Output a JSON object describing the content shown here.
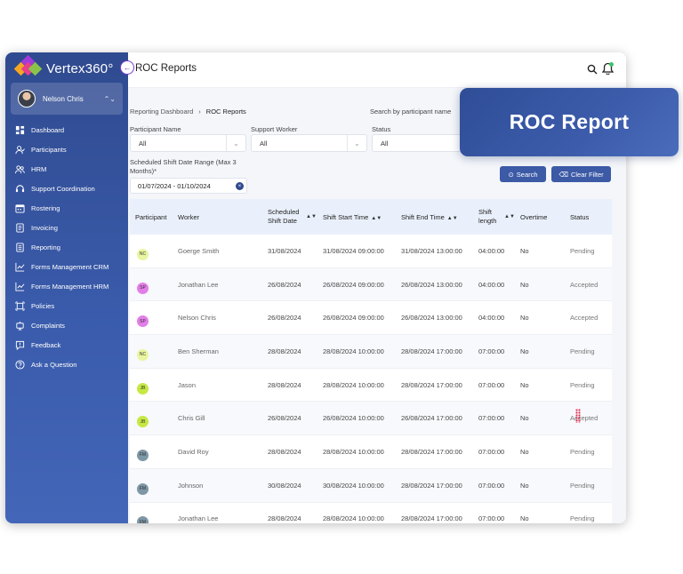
{
  "brand": {
    "name": "Vertex360°"
  },
  "user": {
    "name": "Nelson Chris"
  },
  "sidebar": {
    "items": [
      {
        "label": "Dashboard",
        "icon": "dashboard-icon"
      },
      {
        "label": "Participants",
        "icon": "participants-icon"
      },
      {
        "label": "HRM",
        "icon": "hrm-icon"
      },
      {
        "label": "Support Coordination",
        "icon": "support-icon"
      },
      {
        "label": "Rostering",
        "icon": "calendar-icon"
      },
      {
        "label": "Invoicing",
        "icon": "invoice-icon"
      },
      {
        "label": "Reporting",
        "icon": "report-icon"
      },
      {
        "label": "Forms Management CRM",
        "icon": "chart-icon"
      },
      {
        "label": "Forms Management HRM",
        "icon": "chart-icon"
      },
      {
        "label": "Policies",
        "icon": "policies-icon"
      },
      {
        "label": "Complaints",
        "icon": "complaints-icon"
      },
      {
        "label": "Feedback",
        "icon": "feedback-icon"
      },
      {
        "label": "Ask a Question",
        "icon": "question-icon"
      }
    ]
  },
  "header": {
    "title": "ROC Reports"
  },
  "breadcrumb": {
    "root": "Reporting Dashboard",
    "current": "ROC Reports"
  },
  "filters": {
    "search_label": "Search by participant name",
    "participant_label": "Participant Name",
    "participant_value": "All",
    "worker_label": "Support Worker",
    "worker_value": "All",
    "status_label": "Status",
    "status_value": "All",
    "date_label": "Scheduled Shift Date Range (Max 3 Months)*",
    "date_value": "01/07/2024 - 01/10/2024",
    "search_button": "Search",
    "clear_button": "Clear Filter"
  },
  "table": {
    "headers": {
      "participant": "Participant",
      "worker": "Worker",
      "date": "Scheduled Shift Date",
      "start": "Shift Start Time",
      "end": "Shift End Time",
      "length": "Shift length",
      "overtime": "Overtime",
      "status": "Status"
    },
    "rows": [
      {
        "initials": "NC",
        "badge": "#e9f5a0",
        "worker": "Goerge Smith",
        "date": "31/08/2024",
        "start": "31/08/2024 09:00:00",
        "end": "31/08/2024 13:00:00",
        "length": "04:00:00",
        "overtime": "No",
        "status": "Pending"
      },
      {
        "initials": "SP",
        "badge": "#e27ee8",
        "worker": "Jonathan Lee",
        "date": "26/08/2024",
        "start": "26/08/2024 09:00:00",
        "end": "26/08/2024 13:00:00",
        "length": "04:00:00",
        "overtime": "No",
        "status": "Accepted"
      },
      {
        "initials": "SP",
        "badge": "#e27ee8",
        "worker": "Nelson Chris",
        "date": "26/08/2024",
        "start": "26/08/2024 09:00:00",
        "end": "26/08/2024 13:00:00",
        "length": "04:00:00",
        "overtime": "No",
        "status": "Accepted"
      },
      {
        "initials": "NC",
        "badge": "#e9f5a0",
        "worker": "Ben Sherman",
        "date": "28/08/2024",
        "start": "28/08/2024 10:00:00",
        "end": "28/08/2024 17:00:00",
        "length": "07:00:00",
        "overtime": "No",
        "status": "Pending"
      },
      {
        "initials": "JB",
        "badge": "#c6e844",
        "worker": "Jason",
        "date": "28/08/2024",
        "start": "28/08/2024 10:00:00",
        "end": "28/08/2024 17:00:00",
        "length": "07:00:00",
        "overtime": "No",
        "status": "Pending"
      },
      {
        "initials": "JB",
        "badge": "#c6e844",
        "worker": "Chris Gill",
        "date": "26/08/2024",
        "start": "26/08/2024 10:00:00",
        "end": "26/08/2024 17:00:00",
        "length": "07:00:00",
        "overtime": "No",
        "status": "Accepted"
      },
      {
        "initials": "FM",
        "badge": "#7d97a6",
        "worker": "David Roy",
        "date": "28/08/2024",
        "start": "28/08/2024 10:00:00",
        "end": "28/08/2024 17:00:00",
        "length": "07:00:00",
        "overtime": "No",
        "status": "Pending"
      },
      {
        "initials": "FM",
        "badge": "#7d97a6",
        "worker": "Johnson",
        "date": "30/08/2024",
        "start": "30/08/2024 10:00:00",
        "end": "28/08/2024 17:00:00",
        "length": "07:00:00",
        "overtime": "No",
        "status": "Pending"
      },
      {
        "initials": "FM",
        "badge": "#7d97a6",
        "worker": "Jonathan Lee",
        "date": "28/08/2024",
        "start": "28/08/2024 10:00:00",
        "end": "28/08/2024 17:00:00",
        "length": "07:00:00",
        "overtime": "No",
        "status": "Pending"
      }
    ]
  },
  "card": {
    "title": "ROC Report"
  },
  "colors": {
    "sidebar": "#3a5bab",
    "accent": "#3c5aa6",
    "card": "#3c5cab"
  }
}
